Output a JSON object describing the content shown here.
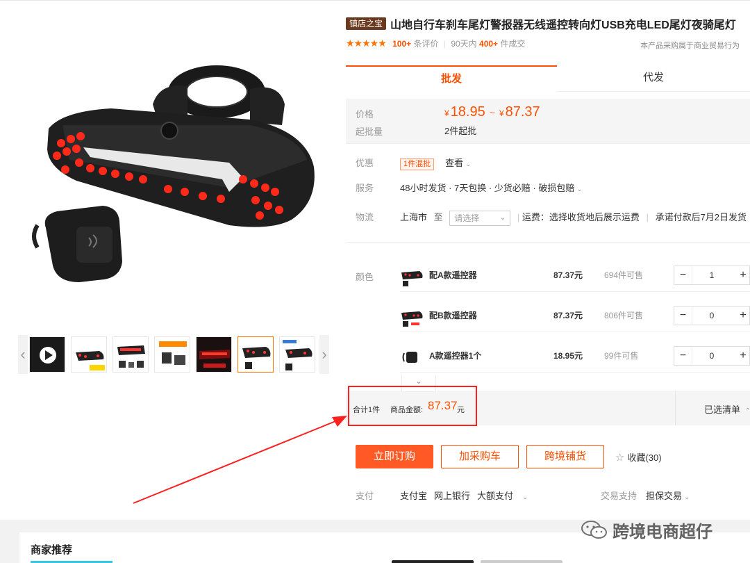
{
  "product": {
    "store_badge": "镇店之宝",
    "title": "山地自行车刹车尾灯警报器无线遥控转向灯USB充电LED尾灯夜骑尾灯",
    "rating_stars": 5,
    "rating_star_glyphs": "★★★★★",
    "reviews_count": "100+",
    "reviews_label": "条评价",
    "sales_period": "90天内",
    "sales_count": "400+",
    "sales_label": "件成交",
    "trade_note": "本产品采购属于商业贸易行为"
  },
  "tabs": {
    "wholesale": "批发",
    "dropship": "代发"
  },
  "price": {
    "label": "价格",
    "currency": "¥",
    "low": "18.95",
    "separator": "~",
    "high": "87.37",
    "min_order_label": "起批量",
    "min_order_value": "2件起批"
  },
  "info": {
    "promo_label": "优惠",
    "promo_tag": "1件混批",
    "promo_link": "查看",
    "service_label": "服务",
    "service_value": "48小时发货 · 7天包换 · 少货必赔 · 破损包赔",
    "logistics_label": "物流",
    "logistics_origin": "上海市",
    "logistics_to": "至",
    "logistics_placeholder": "请选择",
    "logistics_freight": "运费：选择收货地后展示运费",
    "logistics_promise": "承诺付款后7月2日发货"
  },
  "sku": {
    "label": "颜色",
    "items": [
      {
        "name": "配A款遥控器",
        "price": "87.37元",
        "stock": "694件可售",
        "qty": "1"
      },
      {
        "name": "配B款遥控器",
        "price": "87.37元",
        "stock": "806件可售",
        "qty": "0"
      },
      {
        "name": "A款遥控器1个",
        "price": "18.95元",
        "stock": "99件可售",
        "qty": "0"
      }
    ],
    "minus": "−",
    "plus": "+",
    "expand": "⌄"
  },
  "summary": {
    "count_text": "合计1件",
    "amount_label": "商品金额:",
    "amount": "87.37",
    "yuan": "元",
    "selected_list": "已选清单",
    "selected_chevron": "⌃"
  },
  "actions": {
    "buy_now": "立即订购",
    "add_cart": "加采购车",
    "cross_border": "跨境铺货",
    "favorite_icon": "☆",
    "favorite": "收藏(30)"
  },
  "payment": {
    "label": "支付",
    "methods": [
      "支付宝",
      "网上银行",
      "大额支付"
    ],
    "trade_support_label": "交易支持",
    "trade_support_value": "担保交易"
  },
  "gallery": {
    "prev_icon": "‹",
    "next_icon": "›",
    "thumbnail_count": 7,
    "active_index": 5
  },
  "recommend": {
    "title": "商家推荐"
  },
  "watermark": {
    "text": "跨境电商超仔"
  },
  "colors": {
    "accent": "#ff5000",
    "buy_button": "#ff5a26",
    "highlight_box": "#ff2020",
    "store_badge": "#6b3a1e",
    "star": "#ff7300"
  },
  "icons": {
    "thumb_prev": "chevron-left-icon",
    "thumb_next": "chevron-right-icon",
    "favorite": "star-outline-icon",
    "watermark": "wechat-icon"
  }
}
